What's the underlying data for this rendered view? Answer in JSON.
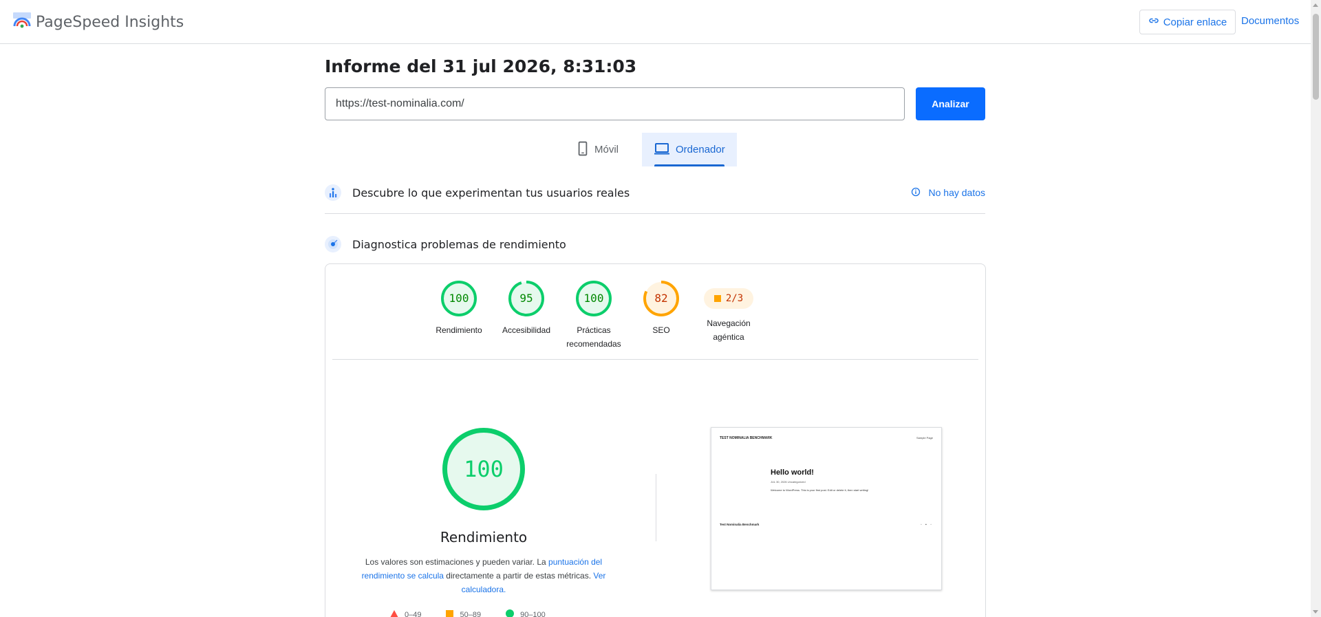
{
  "header": {
    "brand": "PageSpeed Insights",
    "copy_link": "Copiar enlace",
    "docs": "Documentos"
  },
  "report": {
    "title": "Informe del 31 jul 2026, 8:31:03",
    "url_value": "https://test-nominalia.com/",
    "analyze": "Analizar"
  },
  "tabs": {
    "mobile": "Móvil",
    "desktop": "Ordenador",
    "selected": "desktop"
  },
  "crux": {
    "title": "Descubre lo que experimentan tus usuarios reales",
    "nodata": "No hay datos"
  },
  "diagnostics": {
    "title": "Diagnostica problemas de rendimiento"
  },
  "categories": [
    {
      "label": "Rendimiento",
      "score": "100",
      "value": 100,
      "status": "pass"
    },
    {
      "label": "Accesibilidad",
      "score": "95",
      "value": 95,
      "status": "pass"
    },
    {
      "label": "Prácticas recomendadas",
      "score": "100",
      "value": 100,
      "status": "pass"
    },
    {
      "label": "SEO",
      "score": "82",
      "value": 82,
      "status": "average"
    },
    {
      "label": "Navegación agéntica",
      "score": "2/3",
      "status": "average"
    }
  ],
  "performance": {
    "score": "100",
    "value": 100,
    "label": "Rendimiento",
    "desc_1": "Los valores son estimaciones y pueden variar. La ",
    "desc_link_1": "puntuación del rendimiento se calcula",
    "desc_2": " directamente a partir de estas métricas. ",
    "desc_link_2": "Ver calculadora.",
    "legend": {
      "fail": "0–49",
      "average": "50–89",
      "pass": "90–100"
    }
  },
  "preview": {
    "site_title": "TEST NOMINALIA BENCHMARK",
    "sample_page": "Sample Page",
    "post_title": "Hello world!",
    "post_meta": "JUL 30, 2026     Uncategorized",
    "post_body": "Welcome to WordPress. This is your first post. Edit or delete it, then start writing!",
    "footer_title": "Test Nominalia Benchmark",
    "footer_icons": "◦ ▪ ◦"
  },
  "colors": {
    "pass": "#0cce6b",
    "pass_text": "#008800",
    "pass_bg": "#e6f9ee",
    "average": "#ffa400",
    "average_text": "#c33300",
    "average_bg": "#fff3e0",
    "fail": "#ff4e42",
    "link": "#1a73e8"
  }
}
